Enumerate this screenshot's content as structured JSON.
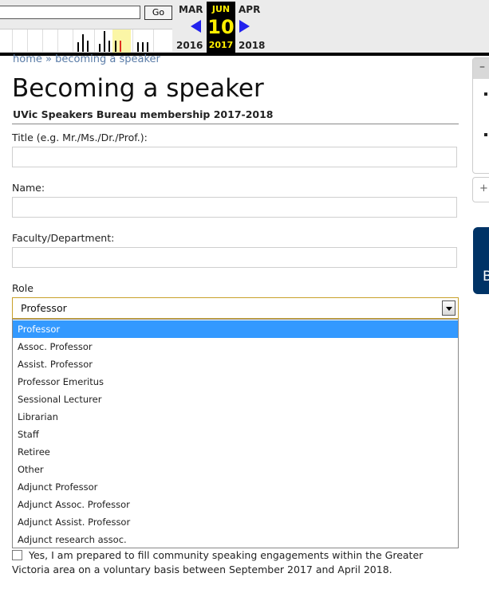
{
  "wayback": {
    "go_label": "Go",
    "prev_month": "MAR",
    "current_month": "JUN",
    "current_day": "10",
    "current_year": "2017",
    "next_month": "APR",
    "prev_year": "2016",
    "next_year": "2018"
  },
  "breadcrumb": {
    "home": "home",
    "separator": "»",
    "current": "becoming a speaker"
  },
  "page": {
    "title": "Becoming a speaker",
    "subtitle": "UVic Speakers Bureau membership 2017-2018"
  },
  "form": {
    "title_label": "Title (e.g. Mr./Ms./Dr./Prof.):",
    "title_value": "",
    "name_label": "Name:",
    "name_value": "",
    "faculty_label": "Faculty/Department:",
    "faculty_value": "",
    "role_label": "Role",
    "role_selected": "Professor",
    "role_options": [
      "Professor",
      "Assoc. Professor",
      "Assist. Professor",
      "Professor Emeritus",
      "Sessional Lecturer",
      "Librarian",
      "Staff",
      "Retiree",
      "Other",
      "Adjunct Professor",
      "Adjunct Assoc. Professor",
      "Adjunct Assist. Professor",
      "Adjunct research assoc."
    ],
    "consent_text": "Yes, I am prepared to fill community speaking engagements within the Greater Victoria area on a voluntary basis between September 2017 and April 2018."
  },
  "sidebar": {
    "collapse_symbol": "–",
    "expand_symbol": "+",
    "banner_letter": "B"
  },
  "colors": {
    "selected_option": "#3399ff",
    "select_focus_border": "#c8a02a",
    "breadcrumb_link": "#5a7ca8",
    "banner": "#003366"
  }
}
